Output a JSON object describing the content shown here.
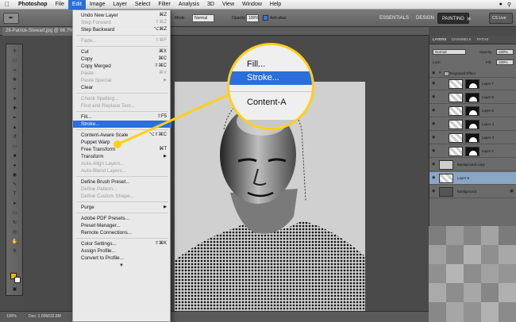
{
  "menubar": {
    "apple": "",
    "app": "Photoshop",
    "items": [
      "File",
      "Edit",
      "Image",
      "Layer",
      "Select",
      "Filter",
      "Analysis",
      "3D",
      "View",
      "Window",
      "Help"
    ],
    "active": "Edit"
  },
  "options": {
    "mode_label": "Mode:",
    "mode_value": "Normal",
    "opacity_label": "Opacity:",
    "opacity_value": "100%",
    "antialias_label": "Anti-alias"
  },
  "workspaces": [
    "ESSENTIALS",
    "DESIGN",
    "PAINTING"
  ],
  "active_workspace": "PAINTING",
  "cs_live": "CS Live",
  "document": {
    "tab_title": "26-Patrick-Stewart.jpg @ 66.7%",
    "zoom": "100%",
    "doc_info": "Doc: 1.00M/32.8M"
  },
  "edit_menu": [
    {
      "label": "Undo New Layer",
      "shortcut": "⌘Z",
      "disabled": false
    },
    {
      "label": "Step Forward",
      "shortcut": "⇧⌘Z",
      "disabled": true
    },
    {
      "label": "Step Backward",
      "shortcut": "⌥⌘Z",
      "disabled": false
    },
    {
      "sep": true
    },
    {
      "label": "Fade...",
      "shortcut": "⇧⌘F",
      "disabled": true
    },
    {
      "sep": true
    },
    {
      "label": "Cut",
      "shortcut": "⌘X",
      "disabled": false
    },
    {
      "label": "Copy",
      "shortcut": "⌘C",
      "disabled": false
    },
    {
      "label": "Copy Merged",
      "shortcut": "⇧⌘C",
      "disabled": false
    },
    {
      "label": "Paste",
      "shortcut": "⌘V",
      "disabled": true
    },
    {
      "label": "Paste Special",
      "submenu": true,
      "disabled": true
    },
    {
      "label": "Clear",
      "disabled": false
    },
    {
      "sep": true
    },
    {
      "label": "Check Spelling...",
      "disabled": true
    },
    {
      "label": "Find and Replace Text...",
      "disabled": true
    },
    {
      "sep": true
    },
    {
      "label": "Fill...",
      "shortcut": "⇧F5",
      "disabled": false
    },
    {
      "label": "Stroke...",
      "disabled": false,
      "highlighted": true
    },
    {
      "sep": true
    },
    {
      "label": "Content-Aware Scale",
      "shortcut": "⌥⇧⌘C",
      "disabled": false
    },
    {
      "label": "Puppet Warp",
      "disabled": false
    },
    {
      "label": "Free Transform",
      "shortcut": "⌘T",
      "disabled": false
    },
    {
      "label": "Transform",
      "submenu": true,
      "disabled": false
    },
    {
      "label": "Auto-Align Layers...",
      "disabled": true
    },
    {
      "label": "Auto-Blend Layers...",
      "disabled": true
    },
    {
      "sep": true
    },
    {
      "label": "Define Brush Preset...",
      "disabled": false
    },
    {
      "label": "Define Pattern...",
      "disabled": true
    },
    {
      "label": "Define Custom Shape...",
      "disabled": true
    },
    {
      "sep": true
    },
    {
      "label": "Purge",
      "submenu": true,
      "disabled": false
    },
    {
      "sep": true
    },
    {
      "label": "Adobe PDF Presets...",
      "disabled": false
    },
    {
      "label": "Preset Manager...",
      "disabled": false
    },
    {
      "label": "Remote Connections...",
      "disabled": false
    },
    {
      "sep": true
    },
    {
      "label": "Color Settings...",
      "shortcut": "⇧⌘K",
      "disabled": false
    },
    {
      "label": "Assign Profile...",
      "disabled": false
    },
    {
      "label": "Convert to Profile...",
      "disabled": false
    }
  ],
  "magnifier": {
    "item1": "Fill...",
    "item2": "Stroke...",
    "item3": "Content-A"
  },
  "layers_panel": {
    "tabs": [
      "LAYERS",
      "CHANNELS",
      "PATHS"
    ],
    "active_tab": "LAYERS",
    "blend_mode": "Normal",
    "opacity_label": "Opacity:",
    "opacity_value": "100%",
    "lock_label": "Lock:",
    "fill_label": "Fill:",
    "fill_value": "100%",
    "layers": [
      {
        "name": "Engraved Effect",
        "kind": "group"
      },
      {
        "name": "Layer 7",
        "kind": "masked"
      },
      {
        "name": "Layer 6",
        "kind": "masked"
      },
      {
        "name": "Layer 5",
        "kind": "masked"
      },
      {
        "name": "Layer 4",
        "kind": "masked"
      },
      {
        "name": "Layer 3",
        "kind": "masked"
      },
      {
        "name": "Layer 2",
        "kind": "masked"
      },
      {
        "name": "Background copy",
        "kind": "single"
      },
      {
        "name": "Layer 8",
        "kind": "single",
        "selected": true
      },
      {
        "name": "Background",
        "kind": "single",
        "locked": true
      }
    ]
  },
  "colors": {
    "highlight": "#2a6fdb",
    "accent": "#ffcf1a",
    "foreground_swatch": "#e8b800"
  }
}
